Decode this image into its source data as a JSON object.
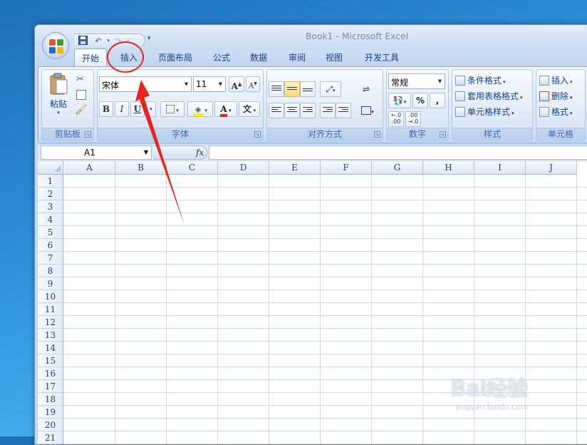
{
  "window": {
    "title": "Book1 - Microsoft Excel"
  },
  "quick_access": {
    "save_icon": "save-icon",
    "undo_icon": "undo-icon",
    "redo_icon": "redo-icon"
  },
  "tabs": [
    "开始",
    "插入",
    "页面布局",
    "公式",
    "数据",
    "审阅",
    "视图",
    "开发工具"
  ],
  "active_tab": "开始",
  "ribbon": {
    "clipboard": {
      "label": "剪贴板",
      "paste": "粘贴"
    },
    "font": {
      "label": "字体",
      "font_name": "宋体",
      "font_size": "11",
      "bold": "B",
      "italic": "I",
      "underline": "U",
      "grow": "A",
      "shrink": "A",
      "font_color": "A",
      "wen": "文"
    },
    "alignment": {
      "label": "对齐方式"
    },
    "number": {
      "label": "数字",
      "format": "常规",
      "percent": "%",
      "comma": ","
    },
    "styles": {
      "label": "样式",
      "conditional": "条件格式",
      "table": "套用表格格式",
      "cell": "单元格样式"
    },
    "cells": {
      "label": "单元格",
      "insert": "插入",
      "delete": "删除",
      "format": "格式"
    }
  },
  "formula_bar": {
    "name_box": "A1",
    "fx": "fx"
  },
  "columns": [
    "A",
    "B",
    "C",
    "D",
    "E",
    "F",
    "G",
    "H",
    "I",
    "J"
  ],
  "rows": [
    "1",
    "2",
    "3",
    "4",
    "5",
    "6",
    "7",
    "8",
    "9",
    "10",
    "11",
    "12",
    "13",
    "14",
    "15",
    "16",
    "17",
    "18",
    "19",
    "20",
    "21"
  ],
  "watermark": {
    "brand": "Bai经验",
    "url": "jingyan.baidu.com"
  },
  "colors": {
    "annotation": "#e8231b"
  }
}
